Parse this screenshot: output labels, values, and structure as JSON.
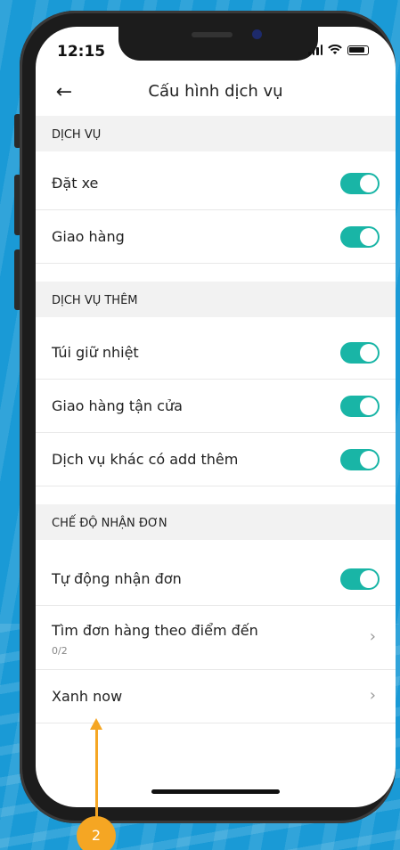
{
  "status_bar": {
    "time": "12:15"
  },
  "header": {
    "title": "Cấu hình dịch vụ"
  },
  "sections": [
    {
      "title": "DỊCH VỤ",
      "items": [
        {
          "label": "Đặt xe",
          "type": "toggle",
          "on": true
        },
        {
          "label": "Giao hàng",
          "type": "toggle",
          "on": true
        }
      ]
    },
    {
      "title": "DỊCH VỤ THÊM",
      "items": [
        {
          "label": "Túi giữ nhiệt",
          "type": "toggle",
          "on": true
        },
        {
          "label": "Giao hàng tận cửa",
          "type": "toggle",
          "on": true
        },
        {
          "label": "Dịch vụ khác có add thêm",
          "type": "toggle",
          "on": true
        }
      ]
    },
    {
      "title": "CHẾ ĐỘ NHẬN ĐƠN",
      "items": [
        {
          "label": "Tự động nhận đơn",
          "type": "toggle",
          "on": true
        },
        {
          "label": "Tìm đơn hàng theo điểm đến",
          "type": "link",
          "subtitle": "0/2"
        },
        {
          "label": "Xanh now",
          "type": "link"
        }
      ]
    }
  ],
  "annotation": {
    "marker": "2"
  },
  "colors": {
    "toggle_on": "#19b5a6",
    "marker": "#f5a623",
    "background": "#1a9ad6"
  }
}
